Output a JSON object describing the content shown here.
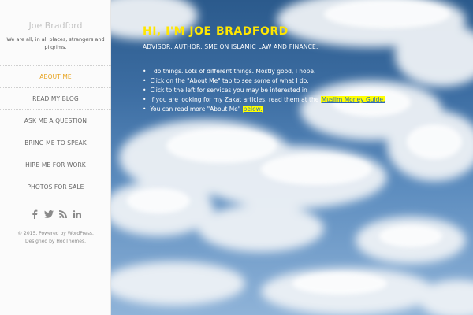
{
  "site": {
    "title": "Joe Bradford",
    "tagline": "We are all, in all places, strangers and pilgrims."
  },
  "menu": {
    "items": [
      {
        "label": "ABOUT ME",
        "active": true
      },
      {
        "label": "READ MY BLOG"
      },
      {
        "label": "ASK ME A QUESTION"
      },
      {
        "label": "BRING ME TO SPEAK"
      },
      {
        "label": "HIRE ME FOR WORK"
      },
      {
        "label": "PHOTOS FOR SALE"
      }
    ]
  },
  "social": [
    "facebook-icon",
    "twitter-icon",
    "rss-icon",
    "linkedin-icon"
  ],
  "footer": {
    "line1": "© 2015, Powered by WordPress.",
    "line2": "Designed by HooThemes."
  },
  "hero": {
    "title": "HI, I'M JOE BRADFORD",
    "subtitle": "ADVISOR. AUTHOR. SME ON ISLAMIC LAW AND FINANCE.",
    "bullets": {
      "b1": "I do things. Lots of different things. Mostly good, I hope.",
      "b2": "Click on the \"About Me\" tab to see some of what I do.",
      "b3": "Click to the left for services you may be interested in",
      "b4_prefix": "If you are looking for my Zakat articles, read them at the ",
      "b4_link": "Muslim Money Guide.",
      "b5_prefix": "You can read more \"About Me\" ",
      "b5_link": "below."
    }
  },
  "colors": {
    "accent": "#e7a21d",
    "hero_title": "#ffe600",
    "highlight": "#ffff00"
  }
}
